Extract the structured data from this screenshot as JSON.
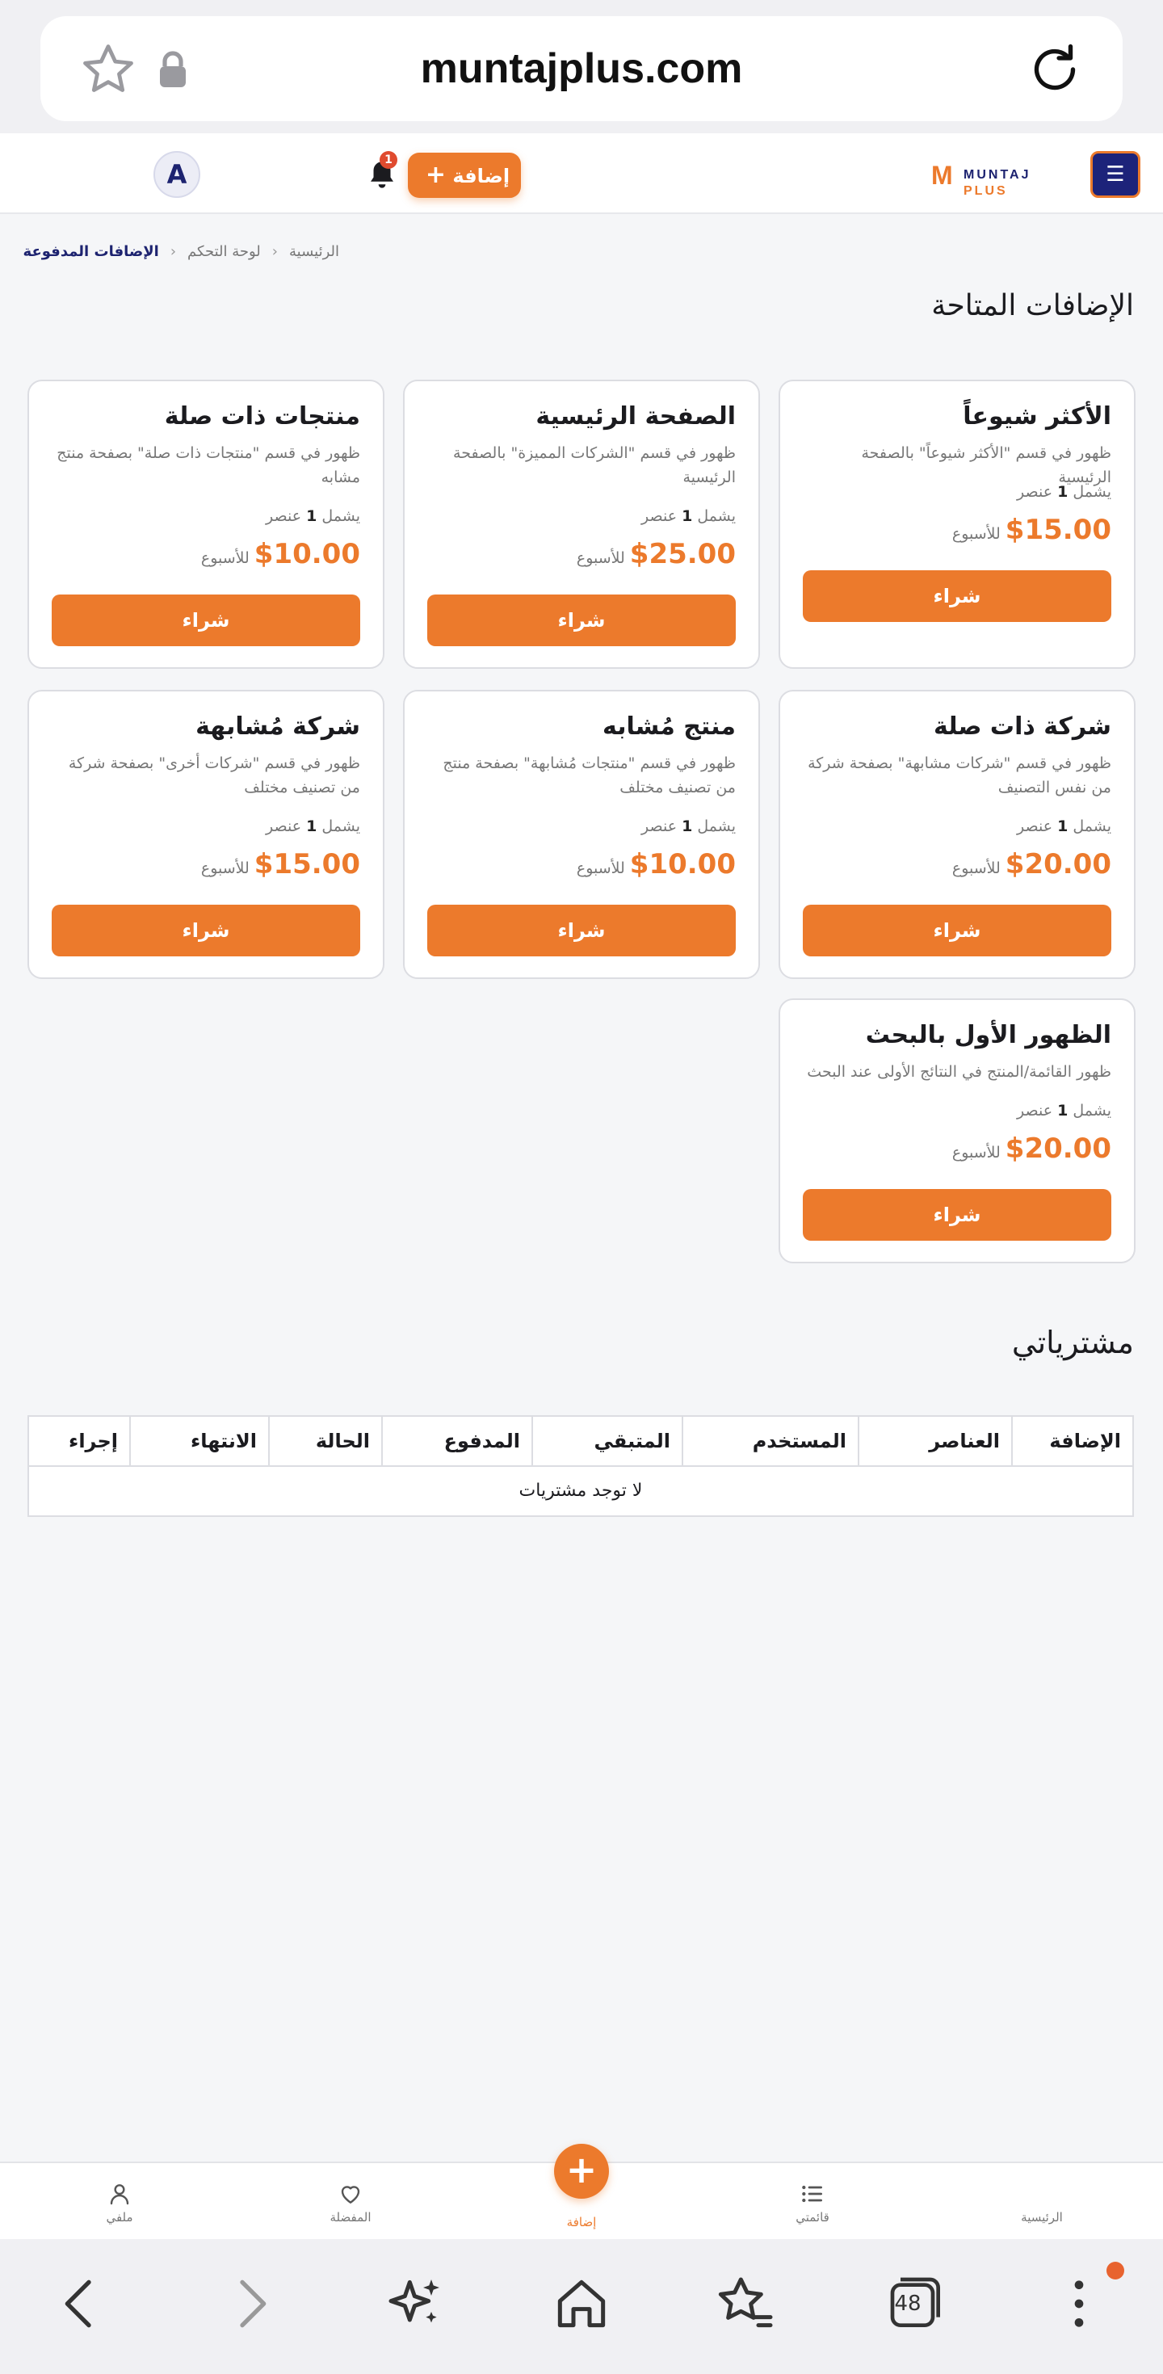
{
  "browser": {
    "url": "muntajplus.com",
    "tab_count": "48"
  },
  "header": {
    "avatar_letter": "A",
    "notification_count": "1",
    "add_label": "إضافة",
    "brand_text": "MUNTAJ",
    "brand_plus": "PLUS"
  },
  "breadcrumb": {
    "home": "الرئيسية",
    "dashboard": "لوحة التحكم",
    "current": "الإضافات المدفوعة"
  },
  "available_title": "الإضافات المتاحة",
  "addons": [
    {
      "title": "الأكثر شيوعاً",
      "desc": "ظهور في قسم \"الأكثر شيوعاً\" بالصفحة الرئيسية",
      "includes_prefix": "يشمل",
      "includes_count": "1",
      "includes_unit": "عنصر",
      "price": "$15.00",
      "per": "للأسبوع",
      "buy": "شراء"
    },
    {
      "title": "الصفحة الرئيسية",
      "desc": "ظهور في قسم \"الشركات المميزة\" بالصفحة الرئيسية",
      "includes_prefix": "يشمل",
      "includes_count": "1",
      "includes_unit": "عنصر",
      "price": "$25.00",
      "per": "للأسبوع",
      "buy": "شراء"
    },
    {
      "title": "منتجات ذات صلة",
      "desc": "ظهور في قسم \"منتجات ذات صلة\" بصفحة منتج مشابه",
      "includes_prefix": "يشمل",
      "includes_count": "1",
      "includes_unit": "عنصر",
      "price": "$10.00",
      "per": "للأسبوع",
      "buy": "شراء"
    },
    {
      "title": "شركة ذات صلة",
      "desc": "ظهور في قسم \"شركات مشابهة\" بصفحة شركة من نفس التصنيف",
      "includes_prefix": "يشمل",
      "includes_count": "1",
      "includes_unit": "عنصر",
      "price": "$20.00",
      "per": "للأسبوع",
      "buy": "شراء"
    },
    {
      "title": "منتج مُشابه",
      "desc": "ظهور في قسم \"منتجات مُشابهة\" بصفحة منتج من تصنيف مختلف",
      "includes_prefix": "يشمل",
      "includes_count": "1",
      "includes_unit": "عنصر",
      "price": "$10.00",
      "per": "للأسبوع",
      "buy": "شراء"
    },
    {
      "title": "شركة مُشابهة",
      "desc": "ظهور في قسم \"شركات أخرى\" بصفحة شركة من تصنيف مختلف",
      "includes_prefix": "يشمل",
      "includes_count": "1",
      "includes_unit": "عنصر",
      "price": "$15.00",
      "per": "للأسبوع",
      "buy": "شراء"
    },
    {
      "title": "الظهور الأول بالبحث",
      "desc": "ظهور القائمة/المنتج في النتائج الأولى عند البحث",
      "includes_prefix": "يشمل",
      "includes_count": "1",
      "includes_unit": "عنصر",
      "price": "$20.00",
      "per": "للأسبوع",
      "buy": "شراء"
    }
  ],
  "purchases": {
    "title": "مشترياتي",
    "columns": [
      "الإضافة",
      "العناصر",
      "المستخدم",
      "المتبقي",
      "المدفوع",
      "الحالة",
      "الانتهاء",
      "إجراء"
    ],
    "empty_text": "لا توجد مشتريات"
  },
  "bottom_nav": {
    "home": "الرئيسية",
    "lists": "قائمتي",
    "add": "إضافة",
    "favorites": "المفضلة",
    "profile": "ملفي"
  },
  "colors": {
    "accent": "#ec7a2c",
    "brand_navy": "#1d2370",
    "background": "#f5f6f8"
  }
}
